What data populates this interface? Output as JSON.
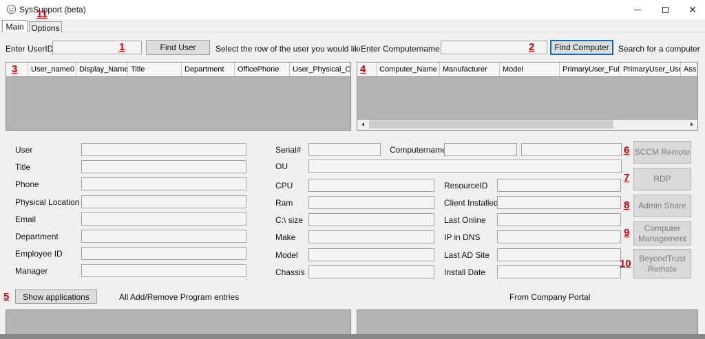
{
  "window": {
    "title": "SysSupport (beta)"
  },
  "tabs": {
    "main": "Main",
    "options": "Options"
  },
  "user_search": {
    "label": "Enter UserID",
    "value": "",
    "find_button": "Find User",
    "instruction": "Select the row of the user you would like m"
  },
  "computer_search": {
    "label": "Enter Computername",
    "value": "",
    "find_button": "Find Computer",
    "instruction": "Search for a computer"
  },
  "user_grid": {
    "columns": [
      "User_name0",
      "Display_Name",
      "Title",
      "Department",
      "OfficePhone",
      "User_Physical_Offi"
    ]
  },
  "computer_grid": {
    "columns": [
      "Computer_Name",
      "Manufacturer",
      "Model",
      "PrimaryUser_Fulll",
      "PrimaryUser_User",
      "Assig"
    ]
  },
  "user_details": {
    "user": "User",
    "title": "Title",
    "phone": "Phone",
    "physical_location": "Physical Location",
    "email": "Email",
    "department": "Department",
    "employee_id": "Employee ID",
    "manager": "Manager"
  },
  "computer_details": {
    "serial": "Serial#",
    "computername": "Computername",
    "ou": "OU",
    "cpu": "CPU",
    "ram": "Ram",
    "c_size": "C:\\ size",
    "make": "Make",
    "model": "Model",
    "chassis": "Chassis",
    "resource_id": "ResourceID",
    "client_installed": "Client Installed",
    "last_online": "Last Online",
    "ip_in_dns": "IP in DNS",
    "last_ad_site": "Last AD Site",
    "install_date": "Install Date"
  },
  "actions": {
    "sccm": "SCCM Remote",
    "rdp": "RDP",
    "admin_share": "Admin Share",
    "computer_management": "Computer Management",
    "beyondtrust": "BeyondTrust Remote"
  },
  "applications": {
    "show_button": "Show applications",
    "all_entries": "All Add/Remove Program entries",
    "company_portal": "From Company Portal"
  },
  "annotations": [
    "1",
    "2",
    "3",
    "4",
    "5",
    "6",
    "7",
    "8",
    "9",
    "10",
    "11"
  ],
  "colors": {
    "annotation": "#d40000",
    "focus_border": "#0f6cbd",
    "grid_bg": "#b3b3b3"
  }
}
